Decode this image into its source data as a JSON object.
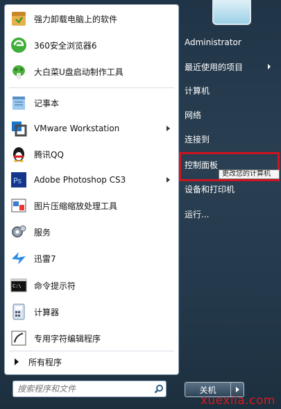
{
  "programs": [
    {
      "label": "强力卸载电脑上的软件",
      "icon": "uninstaller-icon",
      "arrow": false
    },
    {
      "label": "360安全浏览器6",
      "icon": "360-browser-icon",
      "arrow": false
    },
    {
      "label": "大白菜U盘启动制作工具",
      "icon": "dabaicai-icon",
      "arrow": false
    },
    {
      "label": "记事本",
      "icon": "notepad-icon",
      "arrow": false
    },
    {
      "label": "VMware Workstation",
      "icon": "vmware-icon",
      "arrow": true
    },
    {
      "label": "腾讯QQ",
      "icon": "qq-penguin-icon",
      "arrow": false
    },
    {
      "label": "Adobe Photoshop CS3",
      "icon": "photoshop-icon",
      "arrow": true
    },
    {
      "label": "图片压缩缩放处理工具",
      "icon": "image-tool-icon",
      "arrow": false
    },
    {
      "label": "服务",
      "icon": "services-gear-icon",
      "arrow": false
    },
    {
      "label": "迅雷7",
      "icon": "xunlei-bird-icon",
      "arrow": false
    },
    {
      "label": "命令提示符",
      "icon": "cmd-icon",
      "arrow": false
    },
    {
      "label": "计算器",
      "icon": "calculator-icon",
      "arrow": false
    },
    {
      "label": "专用字符编辑程序",
      "icon": "char-editor-icon",
      "arrow": false
    }
  ],
  "all_programs": "所有程序",
  "search": {
    "placeholder": "搜索程序和文件"
  },
  "right_menu": [
    {
      "label": "Administrator",
      "arrow": false
    },
    {
      "label": "最近使用的项目",
      "arrow": true
    },
    {
      "label": "计算机",
      "arrow": false
    },
    {
      "label": "网络",
      "arrow": false
    },
    {
      "label": "连接到",
      "arrow": false
    },
    {
      "label": "控制面板",
      "arrow": false
    },
    {
      "label": "设备和打印机",
      "arrow": false
    },
    {
      "label": "运行...",
      "arrow": false
    }
  ],
  "tooltip": "更改您的计算机",
  "shutdown": {
    "label": "关机"
  },
  "watermark": "xuexila.com",
  "colors": {
    "highlight_border": "#d0141f",
    "watermark": "#d81a1a"
  }
}
